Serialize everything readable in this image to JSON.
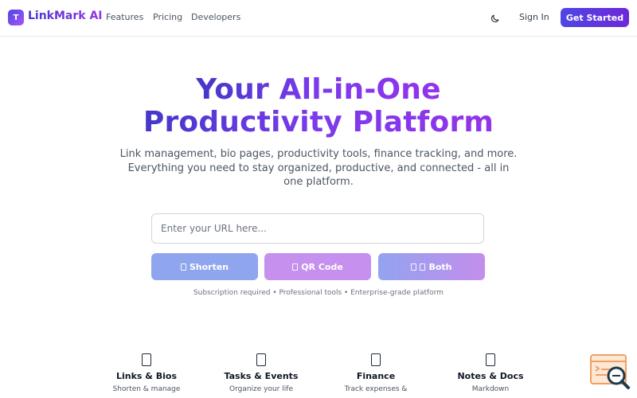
{
  "nav": {
    "logo_letter": "T",
    "brand": "LinkMark AI",
    "links": [
      "Features",
      "Pricing",
      "Developers"
    ],
    "sign_in": "Sign In",
    "get_started": "Get Started"
  },
  "hero": {
    "title_line1": "Your All-in-One",
    "title_line2": "Productivity Platform",
    "subtitle": "Link management, bio pages, productivity tools, finance tracking, and more. Everything you need to stay organized, productive, and connected - all in one platform."
  },
  "url_input": {
    "placeholder": "Enter your URL here...",
    "value": ""
  },
  "actions": {
    "shorten": "Shorten",
    "qr_code": "QR Code",
    "both": "Both"
  },
  "tagline": "Subscription required • Professional tools • Enterprise-grade platform",
  "features": [
    {
      "title": "Links & Bios",
      "desc": "Shorten & manage"
    },
    {
      "title": "Tasks & Events",
      "desc": "Organize your life"
    },
    {
      "title": "Finance",
      "desc": "Track expenses &"
    },
    {
      "title": "Notes & Docs",
      "desc": "Markdown"
    }
  ],
  "colors": {
    "accent": "#4f46e5",
    "accent_purple": "#9333ea",
    "shorten_btn": "#8fa6ef",
    "qr_btn": "#c690ee",
    "help_widget": "#f0a060"
  },
  "icons": {
    "theme_toggle": "moon-icon",
    "help_widget": "chat-search-icon"
  }
}
